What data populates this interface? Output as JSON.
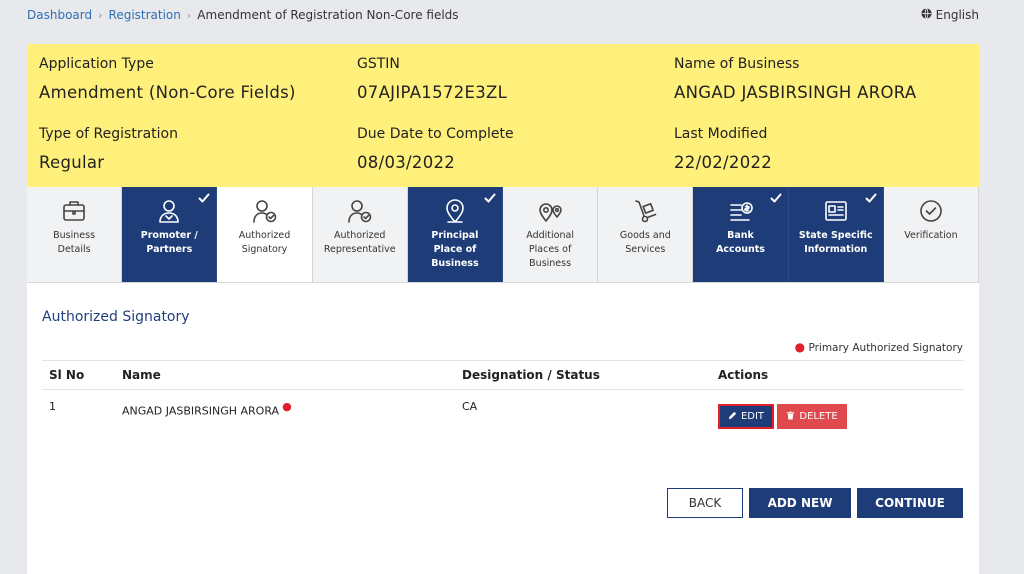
{
  "breadcrumb": {
    "items": [
      "Dashboard",
      "Registration"
    ],
    "current": "Amendment of Registration Non-Core fields"
  },
  "language": {
    "label": "English",
    "icon": "globe-icon"
  },
  "banner": {
    "application_type_label": "Application Type",
    "application_type_value": "Amendment (Non-Core Fields)",
    "gstin_label": "GSTIN",
    "gstin_value": "07AJIPA1572E3ZL",
    "business_name_label": "Name of Business",
    "business_name_value": "ANGAD JASBIRSINGH ARORA",
    "registration_type_label": "Type of Registration",
    "registration_type_value": "Regular",
    "due_date_label": "Due Date to Complete",
    "due_date_value": "08/03/2022",
    "last_modified_label": "Last Modified",
    "last_modified_value": "22/02/2022",
    "color": "#fef07a"
  },
  "tabs": [
    {
      "label": "Business\nDetails",
      "state": "pending",
      "icon": "briefcase-icon"
    },
    {
      "label": "Promoter /\nPartners",
      "state": "done",
      "icon": "person-icon"
    },
    {
      "label": "Authorized\nSignatory",
      "state": "active",
      "icon": "person-badge-icon"
    },
    {
      "label": "Authorized\nRepresentative",
      "state": "pending",
      "icon": "person-badge-icon"
    },
    {
      "label": "Principal\nPlace of\nBusiness",
      "state": "done",
      "icon": "location-pin-icon"
    },
    {
      "label": "Additional\nPlaces of\nBusiness",
      "state": "pending",
      "icon": "location-pins-icon"
    },
    {
      "label": "Goods and\nServices",
      "state": "pending",
      "icon": "hand-truck-icon"
    },
    {
      "label": "Bank\nAccounts",
      "state": "done",
      "icon": "bank-icon"
    },
    {
      "label": "State Specific\nInformation",
      "state": "done",
      "icon": "id-card-icon"
    },
    {
      "label": "Verification",
      "state": "pending",
      "icon": "check-circle-icon"
    }
  ],
  "section": {
    "title": "Authorized Signatory",
    "legend": "Primary Authorized Signatory"
  },
  "table": {
    "headers": [
      "Sl No",
      "Name",
      "Designation / Status",
      "Actions"
    ],
    "rows": [
      {
        "sl_no": "1",
        "name": "ANGAD JASBIRSINGH ARORA",
        "designation": "CA",
        "primary": true
      }
    ],
    "edit_label": "EDIT",
    "delete_label": "DELETE"
  },
  "buttons": {
    "back": "BACK",
    "add_new": "ADD NEW",
    "continue": "CONTINUE"
  },
  "colors": {
    "primary_navy": "#1e3c78",
    "link_blue": "#2f6fb5",
    "danger_red": "#e04a4f",
    "required_dot": "#e0202a"
  }
}
